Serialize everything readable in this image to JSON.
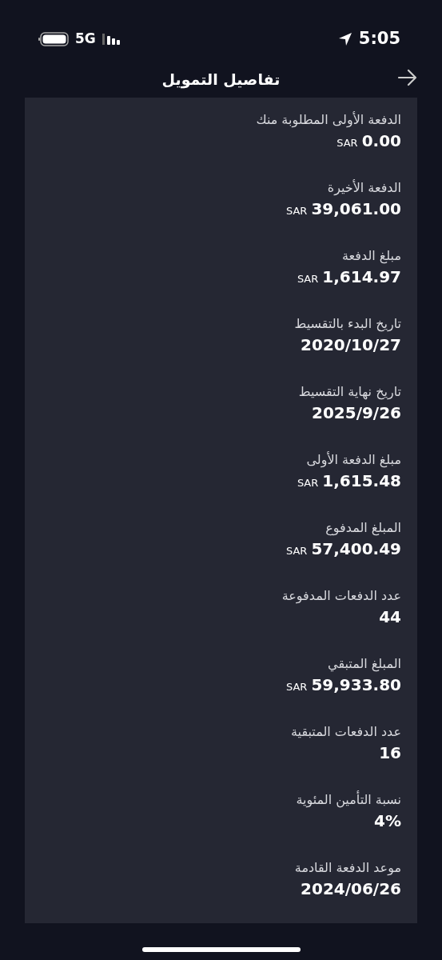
{
  "status_bar": {
    "network": "5G",
    "time": "5:05"
  },
  "header": {
    "title": "تفاصيل التمويل"
  },
  "details": [
    {
      "label": "الدفعة الأولى المطلوبة منك",
      "currency": "SAR",
      "value": "0.00"
    },
    {
      "label": "الدفعة الأخيرة",
      "currency": "SAR",
      "value": "39,061.00"
    },
    {
      "label": "مبلغ الدفعة",
      "currency": "SAR",
      "value": "1,614.97"
    },
    {
      "label": "تاريخ البدء بالتقسيط",
      "value": "2020/10/27"
    },
    {
      "label": "تاريخ نهاية التقسيط",
      "value": "2025/9/26"
    },
    {
      "label": "مبلغ الدفعة الأولى",
      "currency": "SAR",
      "value": "1,615.48"
    },
    {
      "label": "المبلغ المدفوع",
      "currency": "SAR",
      "value": "57,400.49"
    },
    {
      "label": "عدد الدفعات المدفوعة",
      "value": "44"
    },
    {
      "label": "المبلغ المتبقي",
      "currency": "SAR",
      "value": "59,933.80"
    },
    {
      "label": "عدد الدفعات المتبقية",
      "value": "16"
    },
    {
      "label": "نسبة التأمين المئوية",
      "value": "4%"
    },
    {
      "label": "موعد الدفعة القادمة",
      "value": "2024/06/26"
    }
  ]
}
